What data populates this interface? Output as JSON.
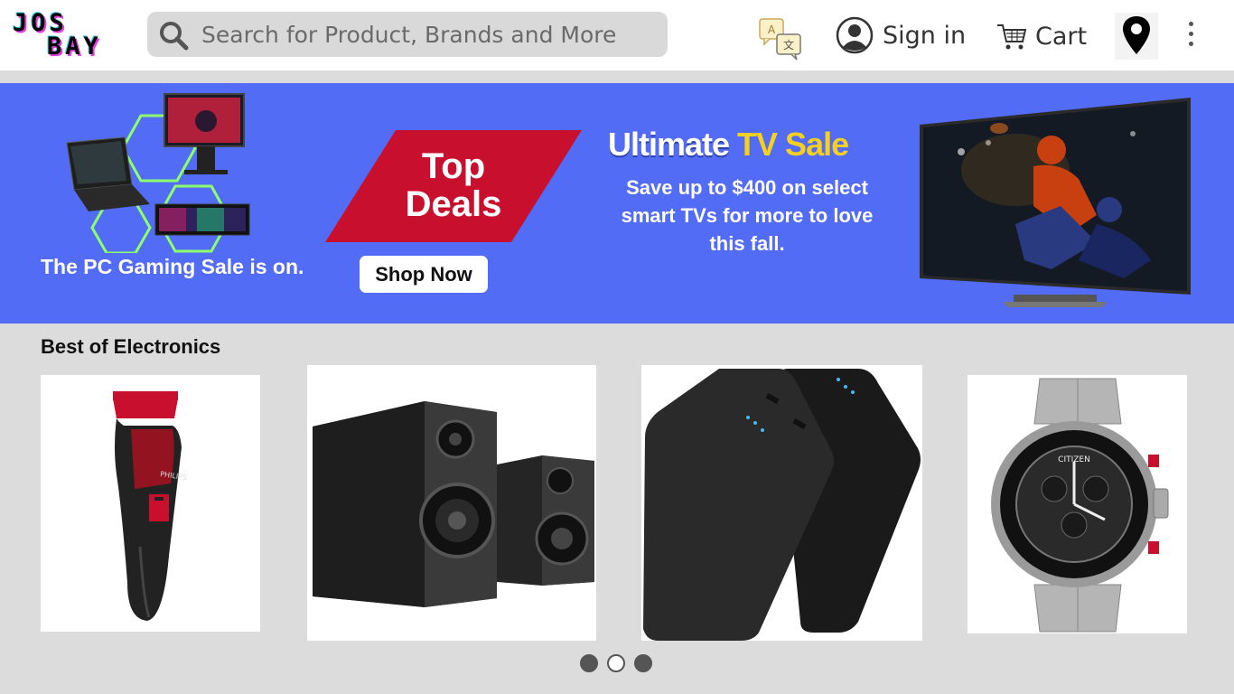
{
  "header": {
    "logo_line1": "JOS",
    "logo_line2": "BAY",
    "search_placeholder": "Search for Product, Brands and More",
    "signin_label": "Sign in",
    "cart_label": "Cart",
    "icons": [
      "search-icon",
      "translate-icon",
      "user-icon",
      "cart-icon",
      "location-pin-icon",
      "more-icon"
    ]
  },
  "banner": {
    "gaming_text": "The PC Gaming Sale is on.",
    "top_deals_line1": "Top",
    "top_deals_line2": "Deals",
    "shop_now_label": "Shop Now",
    "tv_title_white": "Ultimate",
    "tv_title_yellow": "TV Sale",
    "tv_desc": "Save up to $400 on select smart TVs for more to love this fall.",
    "colors": {
      "background": "#536cf5",
      "deal_red": "#c8102e",
      "title_yellow": "#f5d020"
    }
  },
  "section": {
    "title": "Best of Electronics",
    "products": [
      {
        "name": "beard trimmer",
        "brand_text": "PHILIPS"
      },
      {
        "name": "bookshelf speakers"
      },
      {
        "name": "power banks"
      },
      {
        "name": "chronograph watch",
        "brand_text": "CITIZEN"
      }
    ]
  },
  "carousel": {
    "total_dots": 3,
    "active_index": 1
  }
}
